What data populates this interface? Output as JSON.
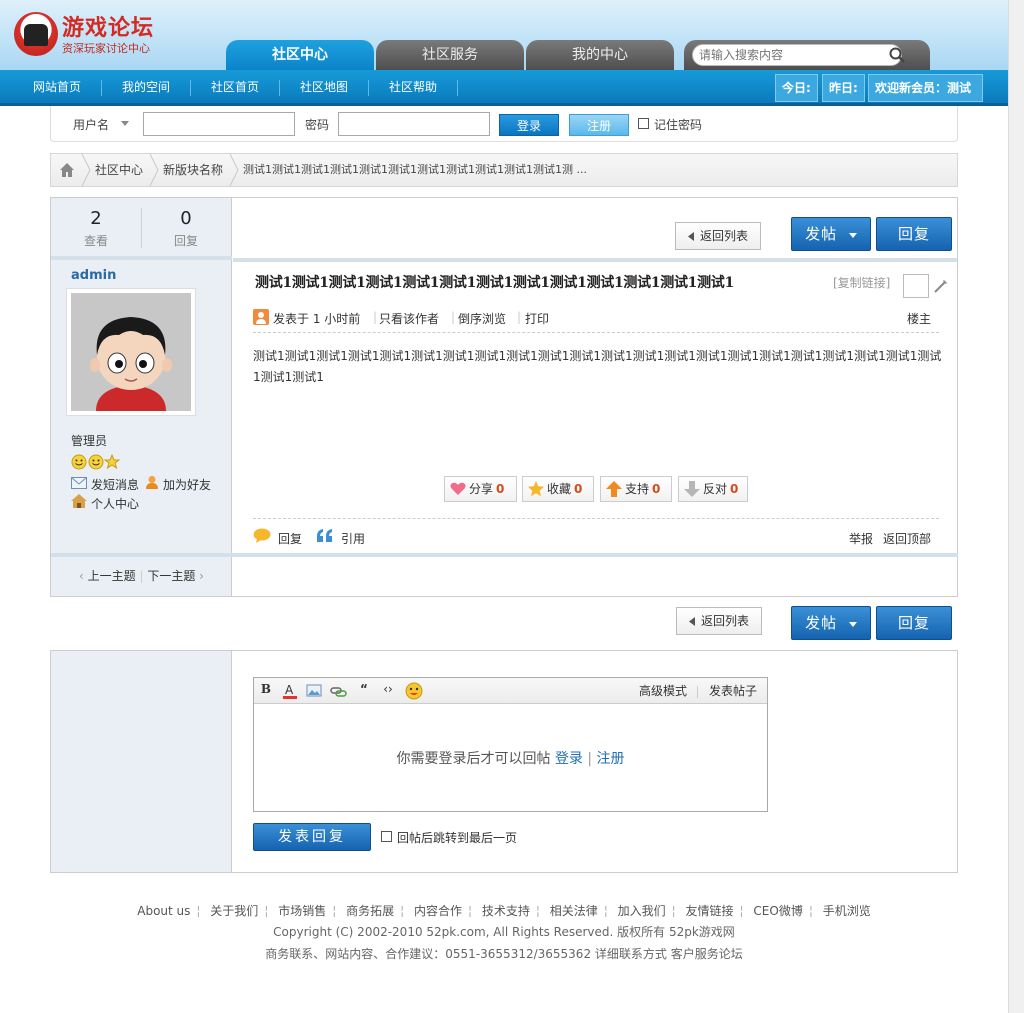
{
  "header": {
    "logo_title": "游戏论坛",
    "logo_subtitle": "资深玩家讨论中心",
    "main_tabs": [
      {
        "label": "社区中心"
      },
      {
        "label": "社区服务"
      },
      {
        "label": "我的中心"
      }
    ],
    "search_placeholder": "请输入搜索内容"
  },
  "nav": {
    "items": [
      "网站首页",
      "我的空间",
      "社区首页",
      "社区地图",
      "社区帮助"
    ],
    "today": "今日:",
    "yesterday": "昨日:",
    "welcome": "欢迎新会员：测试"
  },
  "login": {
    "username_label": "用户名",
    "password_label": "密码",
    "login_btn": "登录",
    "register_btn": "注册",
    "remember": "记住密码"
  },
  "breadcrumb": {
    "items": [
      "社区中心",
      "新版块名称",
      "测试1测试1测试1测试1测试1测试1测试1测试1测试1测试1测试1测 ..."
    ]
  },
  "post": {
    "views": "2",
    "views_label": "查看",
    "replies": "0",
    "replies_label": "回复",
    "author": "admin",
    "role": "管理员",
    "send_msg": "发短消息",
    "add_friend": "加为好友",
    "profile": "个人中心",
    "prev_topic": "上一主题",
    "next_topic": "下一主题",
    "back_btn": "返回列表",
    "new_post_btn": "发帖",
    "reply_btn": "回复",
    "title": "测试1测试1测试1测试1测试1测试1测试1测试1测试1测试1测试1测试1测试1",
    "copy_link": "[复制链接]",
    "posted": "发表于 1 小时前",
    "only_author": "只看该作者",
    "reverse": "倒序浏览",
    "print": "打印",
    "floor": "楼主",
    "body": "测试1测试1测试1测试1测试1测试1测试1测试1测试1测试1测试1测试1测试1测试1测试1测试1测试1测试1测试1测试1测试1测试1测试1测试1",
    "share": {
      "label": "分享",
      "count": "0"
    },
    "favorite": {
      "label": "收藏",
      "count": "0"
    },
    "support": {
      "label": "支持",
      "count": "0"
    },
    "oppose": {
      "label": "反对",
      "count": "0"
    },
    "reply_link": "回复",
    "quote_link": "引用",
    "report": "举报",
    "back_top": "返回顶部"
  },
  "reply": {
    "advanced": "高级模式",
    "post_topic": "发表帖子",
    "need_login": "你需要登录后才可以回帖",
    "login": "登录",
    "sep": "|",
    "register": "注册",
    "submit": "发表回复",
    "jump_last": "回帖后跳转到最后一页"
  },
  "footer": {
    "links": [
      "About us",
      "关于我们",
      "市场销售",
      "商务拓展",
      "内容合作",
      "技术支持",
      "相关法律",
      "加入我们",
      "友情链接",
      "CEO微博",
      "手机浏览"
    ],
    "copyright": "Copyright (C) 2002-2010 52pk.com, All Rights Reserved. 版权所有 52pk游戏网",
    "contact": "商务联系、网站内容、合作建议：0551-3655312/3655362 详细联系方式 客户服务论坛"
  }
}
